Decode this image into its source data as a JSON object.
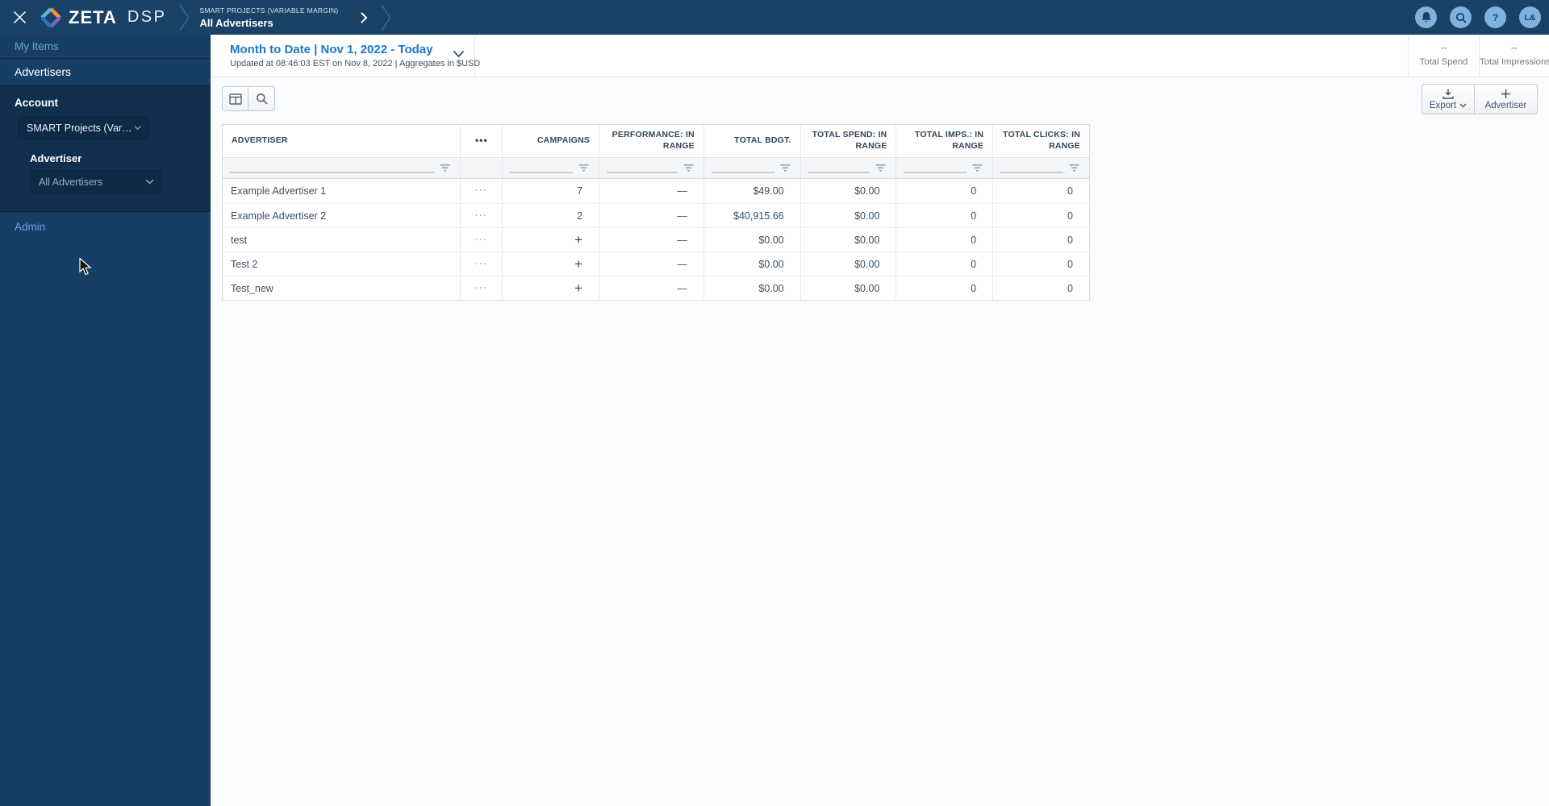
{
  "colors": {
    "topbar_bg": "#1A4166",
    "sidebar_bg": "#173F65",
    "sidebar_panel_bg": "#102F4F",
    "dropdown_bg": "#0C2B47",
    "link_blue": "#69A2DB",
    "accent_blue": "#1B79C9",
    "icon_circle_bg": "#7FB2DC",
    "header_text": "#33475B"
  },
  "topbar": {
    "logo_primary": "ZETA",
    "logo_secondary": "DSP",
    "breadcrumb": {
      "account": "SMART PROJECTS (VARIABLE MARGIN)",
      "page": "All Advertisers"
    },
    "help_glyph": "?",
    "avatar_initials": "L&"
  },
  "sidebar": {
    "items": [
      {
        "label": "My Items"
      },
      {
        "label": "Advertisers"
      },
      {
        "label": "Admin"
      }
    ],
    "account_label": "Account",
    "account_value": "SMART Projects (Variable M",
    "advertiser_label": "Advertiser",
    "advertiser_value": "All Advertisers"
  },
  "header": {
    "date_title": "Month to Date | Nov 1, 2022 - Today",
    "date_subtitle": "Updated at 08:46:03 EST on Nov 8, 2022 | Aggregates in $USD",
    "stats": [
      {
        "value": "--",
        "label": "Total Spend"
      },
      {
        "value": "--",
        "label": "Total Impressions"
      }
    ]
  },
  "toolbar": {
    "export_label": "Export",
    "advertiser_label": "Advertiser"
  },
  "table": {
    "columns": [
      {
        "label": "ADVERTISER"
      },
      {
        "label": "•••"
      },
      {
        "label": "CAMPAIGNS"
      },
      {
        "label": "PERFORMANCE: IN RANGE"
      },
      {
        "label": "TOTAL BDGT."
      },
      {
        "label": "TOTAL SPEND: IN RANGE"
      },
      {
        "label": "TOTAL IMPS.: IN RANGE"
      },
      {
        "label": "TOTAL CLICKS: IN RANGE"
      }
    ],
    "rows": [
      [
        "Example Advertiser 1",
        "···",
        "7",
        "—",
        "$49.00",
        "$0.00",
        "0",
        "0"
      ],
      [
        "Example Advertiser 2",
        "···",
        "2",
        "—",
        "$40,915.66",
        "$0.00",
        "0",
        "0"
      ],
      [
        "test",
        "···",
        "+",
        "—",
        "$0.00",
        "$0.00",
        "0",
        "0"
      ],
      [
        "Test 2",
        "···",
        "+",
        "—",
        "$0.00",
        "$0.00",
        "0",
        "0"
      ],
      [
        "Test_new",
        "···",
        "+",
        "—",
        "$0.00",
        "$0.00",
        "0",
        "0"
      ]
    ]
  }
}
